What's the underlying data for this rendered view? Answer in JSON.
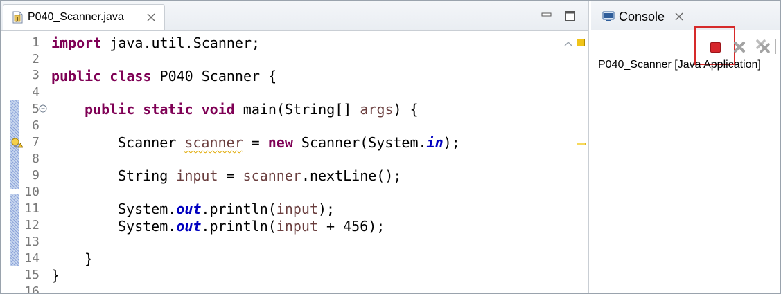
{
  "editor": {
    "tab": {
      "title": "P040_Scanner.java",
      "icon": "java-file-icon"
    },
    "line_numbers": [
      "1",
      "2",
      "3",
      "4",
      "5",
      "6",
      "7",
      "8",
      "9",
      "10",
      "11",
      "12",
      "13",
      "14",
      "15",
      "16"
    ],
    "code": {
      "l1_kw": "import",
      "l1_rest": " java.util.Scanner;",
      "l3_kw": "public class",
      "l3_rest": " P040_Scanner {",
      "l5_kw": "public static void",
      "l5_a": " main(String[] ",
      "l5_var": "args",
      "l5_b": ") {",
      "l7_a": "Scanner ",
      "l7_var": "scanner",
      "l7_b": " = ",
      "l7_kw": "new",
      "l7_c": " Scanner(System.",
      "l7_sf": "in",
      "l7_d": ");",
      "l9_a": "String ",
      "l9_var1": "input",
      "l9_b": " = ",
      "l9_var2": "scanner",
      "l9_c": ".nextLine();",
      "l11_a": "System.",
      "l11_sf": "out",
      "l11_b": ".println(",
      "l11_var": "input",
      "l11_c": ");",
      "l12_a": "System.",
      "l12_sf": "out",
      "l12_b": ".println(",
      "l12_var": "input",
      "l12_c": " + 456);",
      "l14": "}",
      "l15": "}"
    }
  },
  "console": {
    "tab": {
      "title": "Console",
      "icon": "console-icon"
    },
    "description": "P040_Scanner [Java Application]",
    "toolbar": [
      "terminate-icon",
      "remove-launch-icon",
      "remove-all-terminated-icon"
    ]
  },
  "colors": {
    "keyword": "#7f0055",
    "local_variable": "#6a3e3e",
    "static_field": "#0000c0",
    "highlight_border": "#d62a2a",
    "terminate_button": "#d6262c"
  }
}
